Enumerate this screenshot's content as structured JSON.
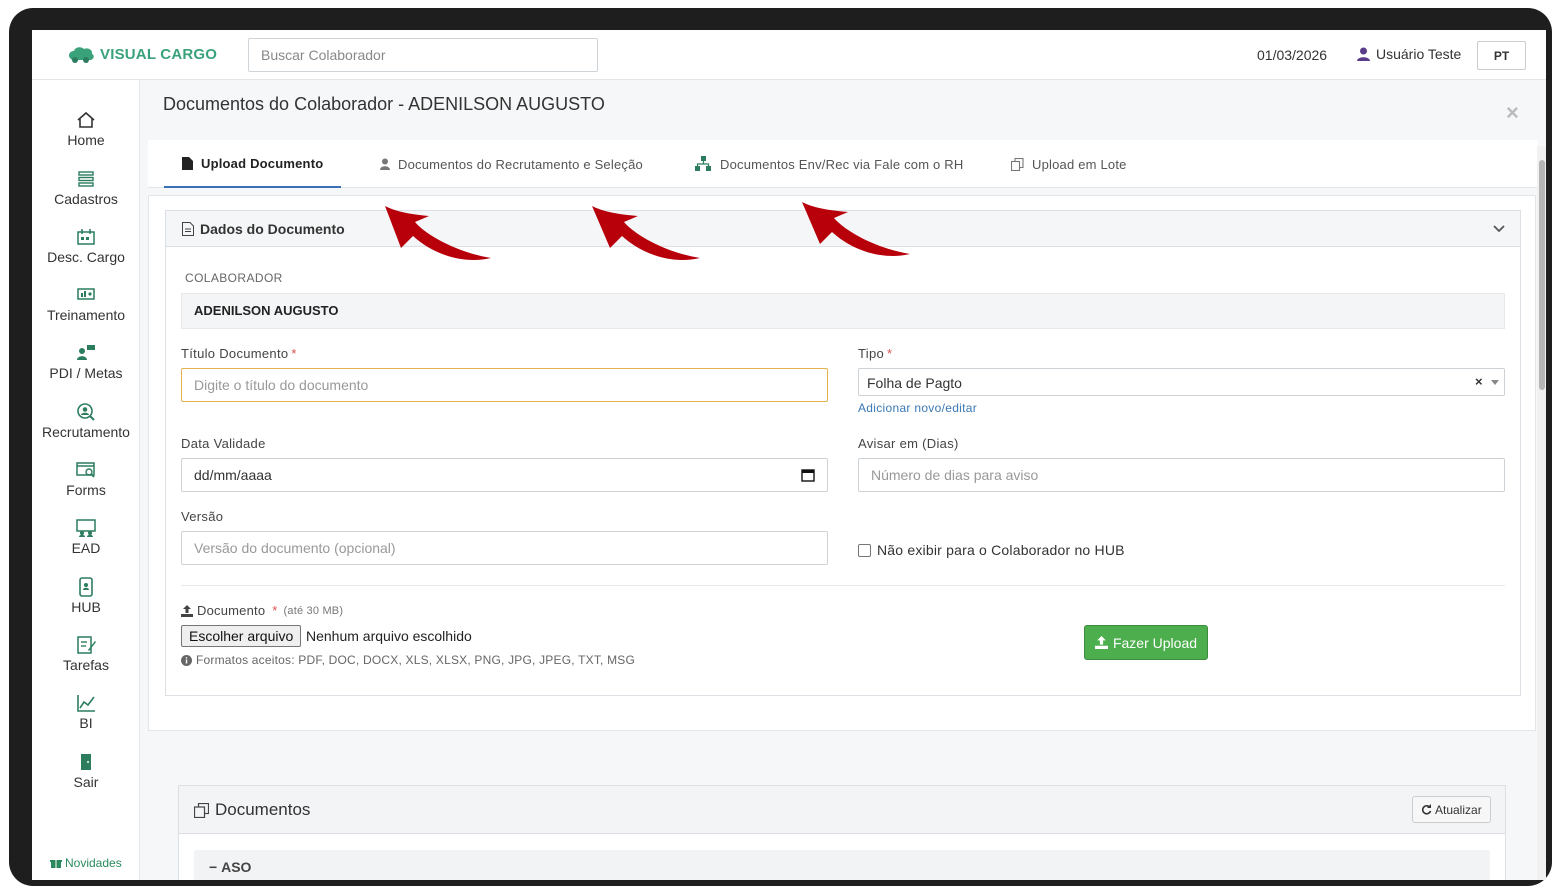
{
  "app": {
    "logo_text": "VISUAL CARGO"
  },
  "topbar": {
    "search_placeholder": "Buscar Colaborador",
    "date": "01/03/2026",
    "user_name": "Usuário Teste",
    "language": "PT"
  },
  "sidebar": {
    "items": [
      {
        "label": "Home",
        "icon": "home-icon"
      },
      {
        "label": "Cadastros",
        "icon": "list-icon"
      },
      {
        "label": "Desc. Cargo",
        "icon": "calendar-icon"
      },
      {
        "label": "Treinamento",
        "icon": "presentation-icon"
      },
      {
        "label": "PDI / Metas",
        "icon": "user-goals-icon"
      },
      {
        "label": "Recrutamento",
        "icon": "search-user-icon"
      },
      {
        "label": "Forms",
        "icon": "form-icon"
      },
      {
        "label": "EAD",
        "icon": "classroom-icon"
      },
      {
        "label": "HUB",
        "icon": "mobile-icon"
      },
      {
        "label": "Tarefas",
        "icon": "task-icon"
      },
      {
        "label": "BI",
        "icon": "chart-icon"
      },
      {
        "label": "Sair",
        "icon": "exit-icon"
      }
    ],
    "novidades": "Novidades"
  },
  "page": {
    "title": "Documentos do Colaborador - ADENILSON AUGUSTO",
    "close": "×"
  },
  "tabs": [
    {
      "label": "Upload Documento",
      "active": true
    },
    {
      "label": "Documentos do Recrutamento e Seleção",
      "active": false
    },
    {
      "label": "Documentos Env/Rec via Fale com o RH",
      "active": false
    },
    {
      "label": "Upload em Lote",
      "active": false
    }
  ],
  "form": {
    "panel_title": "Dados do Documento",
    "colaborador_label": "COLABORADOR",
    "colaborador_value": "ADENILSON AUGUSTO",
    "titulo_label": "Título Documento",
    "titulo_placeholder": "Digite o título do documento",
    "required_mark": "*",
    "tipo_label": "Tipo",
    "tipo_value": "Folha de Pagto",
    "tipo_clear": "×",
    "tipo_link": "Adicionar novo/editar",
    "validade_label": "Data Validade",
    "validade_value": "dd/mm/aaaa",
    "avisar_label": "Avisar em (Dias)",
    "avisar_placeholder": "Número de dias para aviso",
    "versao_label": "Versão",
    "versao_placeholder": "Versão do documento (opcional)",
    "hub_checkbox_label": "Não exibir para o Colaborador no HUB",
    "hub_checked": false,
    "documento_label": "Documento",
    "documento_limit": "(até 30 MB)",
    "file_button": "Escolher arquivo",
    "file_status": "Nenhum arquivo escolhido",
    "formats": "Formatos aceitos: PDF, DOC, DOCX, XLS, XLSX, PNG, JPG, JPEG, TXT, MSG",
    "upload_button": "Fazer Upload"
  },
  "documents": {
    "title": "Documentos",
    "refresh": "Atualizar",
    "groups": [
      {
        "label": "ASO",
        "toggle": "−"
      }
    ]
  },
  "colors": {
    "brand": "#3aa27b",
    "tab_active_border": "#3b6fb6",
    "upload_button": "#4cae4c",
    "required": "#d9534f",
    "annotation_arrow": "#b8000b"
  }
}
